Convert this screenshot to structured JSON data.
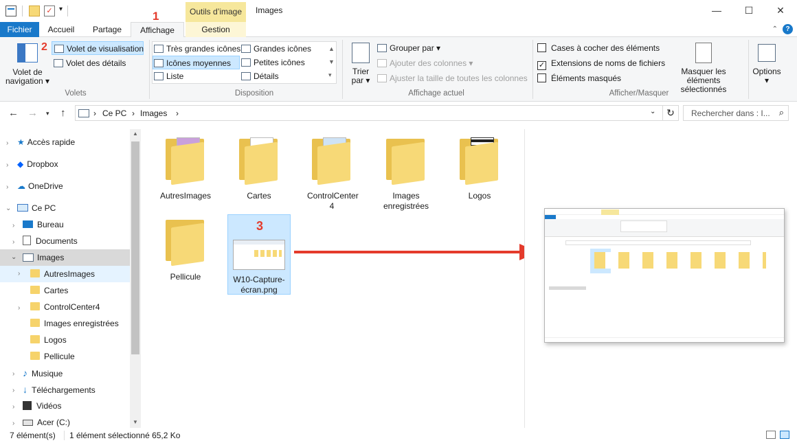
{
  "window": {
    "title": "Images",
    "context_tab_header": "Outils d’image",
    "minimize": "—",
    "maximize": "☐",
    "close": "✕"
  },
  "tabs": {
    "file": "Fichier",
    "home": "Accueil",
    "share": "Partage",
    "view": "Affichage",
    "manage": "Gestion",
    "help": "?"
  },
  "annotations": {
    "n1": "1",
    "n2": "2",
    "n3": "3"
  },
  "ribbon": {
    "panes": {
      "nav_pane": "Volet de navigation",
      "preview_pane": "Volet de visualisation",
      "details_pane": "Volet des détails",
      "label": "Volets"
    },
    "layout": {
      "items": [
        "Très grandes icônes",
        "Grandes icônes",
        "Icônes moyennes",
        "Petites icônes",
        "Liste",
        "Détails"
      ],
      "selected": "Icônes moyennes",
      "label": "Disposition"
    },
    "current_view": {
      "sort_by": "Trier par",
      "group_by": "Grouper par",
      "add_columns": "Ajouter des colonnes",
      "fit_columns": "Ajuster la taille de toutes les colonnes",
      "label": "Affichage actuel"
    },
    "show_hide": {
      "item_checkboxes": "Cases à cocher des éléments",
      "extensions": "Extensions de noms de fichiers",
      "hidden_items": "Éléments masqués",
      "hide_selected": "Masquer les éléments sélectionnés",
      "extensions_checked": true,
      "label": "Afficher/Masquer"
    },
    "options": "Options"
  },
  "address": {
    "crumbs": [
      "Ce PC",
      "Images"
    ],
    "search_placeholder": "Rechercher dans : I..."
  },
  "sidebar": {
    "items": [
      {
        "label": "Accès rapide"
      },
      {
        "label": "Dropbox"
      },
      {
        "label": "OneDrive"
      },
      {
        "label": "Ce PC"
      },
      {
        "label": "Bureau"
      },
      {
        "label": "Documents"
      },
      {
        "label": "Images"
      },
      {
        "label": "AutresImages"
      },
      {
        "label": "Cartes"
      },
      {
        "label": "ControlCenter4"
      },
      {
        "label": "Images enregistrées"
      },
      {
        "label": "Logos"
      },
      {
        "label": "Pellicule"
      },
      {
        "label": "Musique"
      },
      {
        "label": "Téléchargements"
      },
      {
        "label": "Vidéos"
      },
      {
        "label": "Acer (C:)"
      }
    ]
  },
  "files": [
    {
      "name": "AutresImages"
    },
    {
      "name": "Cartes"
    },
    {
      "name": "ControlCenter 4"
    },
    {
      "name": "Images enregistrées"
    },
    {
      "name": "Logos"
    },
    {
      "name": "Pellicule"
    },
    {
      "name": "W10-Capture-écran.png"
    }
  ],
  "status": {
    "count": "7 élément(s)",
    "selection": "1 élément sélectionné  65,2 Ko"
  },
  "colors": {
    "accent": "#1979ca",
    "annotation_red": "#e43b2c",
    "selection": "#cce8ff"
  }
}
